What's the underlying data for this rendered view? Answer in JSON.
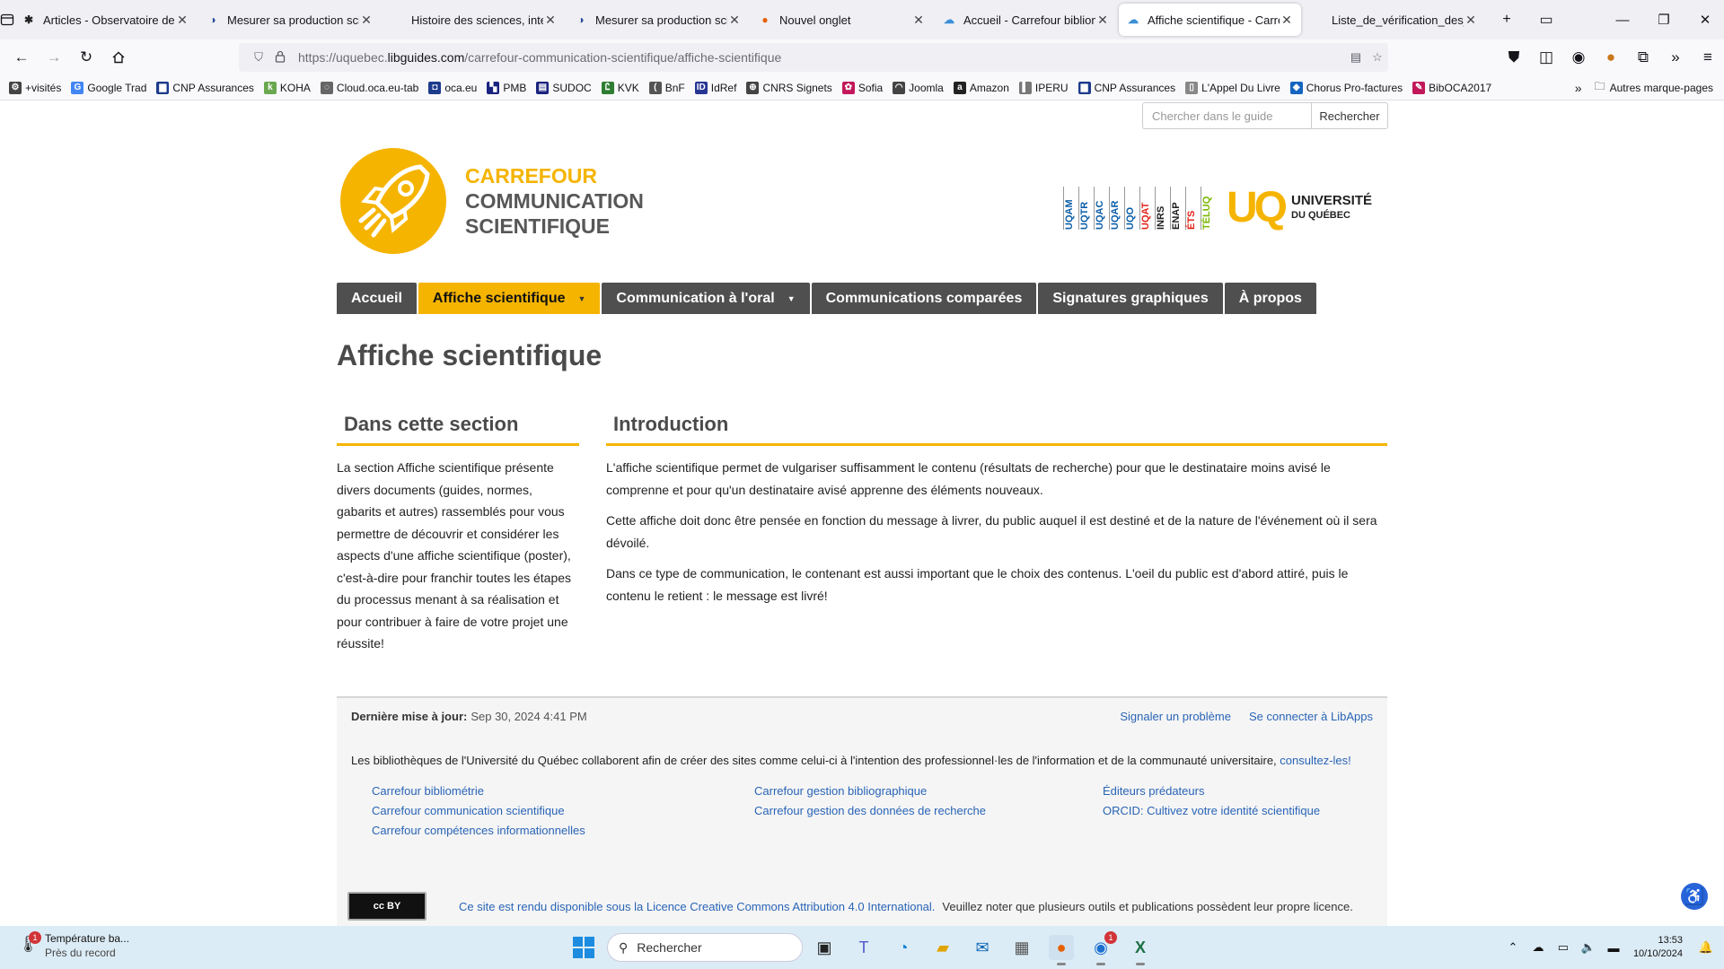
{
  "browser": {
    "tabs": [
      {
        "title": "Articles - Observatoire de la",
        "icon": "joomla-icon",
        "active": false
      },
      {
        "title": "Mesurer sa production scie",
        "icon": "libguides-icon",
        "active": false
      },
      {
        "title": "Histoire des sciences, interf",
        "icon": "none",
        "active": false
      },
      {
        "title": "Mesurer sa production scie",
        "icon": "libguides-icon",
        "active": false
      },
      {
        "title": "Nouvel onglet",
        "icon": "firefox-icon",
        "active": false
      },
      {
        "title": "Accueil - Carrefour bibliom",
        "icon": "cloud-icon",
        "active": false
      },
      {
        "title": "Affiche scientifique - Carre",
        "icon": "cloud-icon",
        "active": true
      },
      {
        "title": "Liste_de_vérification_des_cc",
        "icon": "none",
        "active": false
      }
    ],
    "url_prefix": "https://uquebec.",
    "url_domain": "libguides.com",
    "url_path": "/carrefour-communication-scientifique/affiche-scientifique",
    "bookmarks": [
      {
        "label": "+visités",
        "icon": "gear-icon",
        "color": "#444444"
      },
      {
        "label": "Google Trad",
        "icon": "translate-icon",
        "color": "#4285f4"
      },
      {
        "label": "CNP Assurances",
        "icon": "cnp-icon",
        "color": "#1d3b8c"
      },
      {
        "label": "KOHA",
        "icon": "koha-icon",
        "color": "#6aa84f"
      },
      {
        "label": "Cloud.oca.eu-tab",
        "icon": "cloud-icon",
        "color": "#666666"
      },
      {
        "label": "oca.eu",
        "icon": "oca-icon",
        "color": "#1d3b8c"
      },
      {
        "label": "PMB",
        "icon": "pmb-icon",
        "color": "#1a237e"
      },
      {
        "label": "SUDOC",
        "icon": "sudoc-icon",
        "color": "#1a237e"
      },
      {
        "label": "KVK",
        "icon": "kvk-icon",
        "color": "#2e7d32"
      },
      {
        "label": "BnF",
        "icon": "bnf-icon",
        "color": "#555555"
      },
      {
        "label": "IdRef",
        "icon": "idref-icon",
        "color": "#283593"
      },
      {
        "label": "CNRS Signets",
        "icon": "globe-icon",
        "color": "#444444"
      },
      {
        "label": "Sofia",
        "icon": "sofia-icon",
        "color": "#c2185b"
      },
      {
        "label": "Joomla",
        "icon": "joomla-icon",
        "color": "#444444"
      },
      {
        "label": "Amazon",
        "icon": "amazon-icon",
        "color": "#222222"
      },
      {
        "label": "IPERU",
        "icon": "iperu-icon",
        "color": "#777777"
      },
      {
        "label": "CNP Assurances",
        "icon": "cnp-icon",
        "color": "#1d3b8c"
      },
      {
        "label": "L'Appel Du Livre",
        "icon": "page-icon",
        "color": "#888888"
      },
      {
        "label": "Chorus Pro-factures",
        "icon": "chorus-icon",
        "color": "#1565c0"
      },
      {
        "label": "BibOCA2017",
        "icon": "pen-icon",
        "color": "#c2185b"
      }
    ],
    "other_bookmarks": "Autres marque-pages"
  },
  "page": {
    "search_placeholder": "Chercher dans le guide",
    "search_button": "Rechercher",
    "logo": {
      "line1": "CARREFOUR",
      "line2": "COMMUNICATION",
      "line3": "SCIENTIFIQUE"
    },
    "uq": {
      "institutions": [
        {
          "name": "UQAM",
          "color": "#0b5ea8"
        },
        {
          "name": "UQTR",
          "color": "#0b5ea8"
        },
        {
          "name": "UQAC",
          "color": "#0b5ea8"
        },
        {
          "name": "UQAR",
          "color": "#0b5ea8"
        },
        {
          "name": "UQO",
          "color": "#0b5ea8"
        },
        {
          "name": "UQAT",
          "color": "#e2231a"
        },
        {
          "name": "INRS",
          "color": "#222222"
        },
        {
          "name": "ENAP",
          "color": "#222222"
        },
        {
          "name": "ÉTS",
          "color": "#e2231a"
        },
        {
          "name": "TÉLUQ",
          "color": "#7ab800"
        }
      ],
      "letters": "UQ",
      "name_line1": "UNIVERSITÉ",
      "name_line2": "DU QUÉBEC"
    },
    "nav": [
      {
        "label": "Accueil",
        "active": false,
        "dropdown": false
      },
      {
        "label": "Affiche scientifique",
        "active": true,
        "dropdown": true
      },
      {
        "label": "Communication à l'oral",
        "active": false,
        "dropdown": true
      },
      {
        "label": "Communications comparées",
        "active": false,
        "dropdown": false
      },
      {
        "label": "Signatures graphiques",
        "active": false,
        "dropdown": false
      },
      {
        "label": "À propos",
        "active": false,
        "dropdown": false
      }
    ],
    "title": "Affiche scientifique",
    "side": {
      "title": "Dans cette section",
      "text": "La section Affiche scientifique présente divers documents (guides, normes, gabarits et autres) rassemblés pour vous permettre de découvrir et considérer les aspects d'une affiche scientifique (poster), c'est-à-dire pour franchir toutes les étapes du processus menant à sa réalisation et pour contribuer à faire de votre projet une réussite!"
    },
    "intro": {
      "title": "Introduction",
      "p1": "L'affiche scientifique permet de vulgariser suffisamment le contenu (résultats de recherche) pour que le destinataire moins avisé le comprenne et pour qu'un destinataire avisé apprenne des éléments nouveaux.",
      "p2": "Cette affiche doit donc être pensée en fonction du message à livrer, du public auquel il est destiné et de la nature de l'événement où il sera dévoilé.",
      "p3": "Dans ce type de communication, le contenant est aussi important que le choix des contenus. L'oeil du public est d'abord attiré, puis le contenu le retient : le message est livré!"
    },
    "footer": {
      "updated_label": "Dernière mise à jour:",
      "updated_value": "Sep 30, 2024 4:41 PM",
      "report": "Signaler un problème",
      "login": "Se connecter à LibApps",
      "collab_text": "Les bibliothèques de l'Université du Québec collaborent afin de créer des sites comme celui-ci à l'intention des professionnel·les de l'information et de la communauté universitaire,",
      "collab_link": "consultez-les!",
      "links_col1": [
        "Carrefour bibliométrie",
        "Carrefour communication scientifique",
        "Carrefour compétences informationnelles"
      ],
      "links_col2": [
        "Carrefour gestion bibliographique",
        "Carrefour gestion des données de recherche"
      ],
      "links_col3": [
        "Éditeurs prédateurs",
        "ORCID: Cultivez votre identité scientifique"
      ],
      "license_link": "Ce site est rendu disponible sous la Licence Creative Commons Attribution 4.0 International.",
      "license_note": "Veuillez noter que plusieurs outils et publications possèdent leur propre licence.",
      "cc_badge": "cc BY"
    }
  },
  "taskbar": {
    "weather_title": "Température ba...",
    "weather_sub": "Près du record",
    "weather_badge": "1",
    "search_placeholder": "Rechercher",
    "time": "13:53",
    "date": "10/10/2024",
    "thunderbird_badge": "1",
    "colors": {
      "accent": "#f5b400",
      "nav_dark": "#4f4f4f",
      "link": "#2964b6"
    }
  }
}
